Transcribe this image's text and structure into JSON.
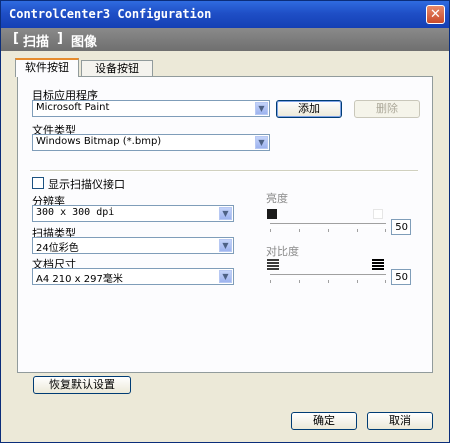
{
  "window": {
    "title": "ControlCenter3 Configuration"
  },
  "header": {
    "tab_scan": "扫描",
    "tab_image": "图像",
    "bracket_left": "[",
    "bracket_right": "]"
  },
  "tabs": [
    {
      "label": "软件按钮"
    },
    {
      "label": "设备按钮"
    }
  ],
  "target_app": {
    "label": "目标应用程序",
    "value": "Microsoft Paint",
    "add_label": "添加",
    "delete_label": "删除"
  },
  "file_type": {
    "label": "文件类型",
    "value": "Windows Bitmap (*.bmp)"
  },
  "show_interface": {
    "label": "显示扫描仪接口",
    "checked": false
  },
  "resolution": {
    "label": "分辨率",
    "value": "300 x 300 dpi"
  },
  "scan_type": {
    "label": "扫描类型",
    "value": "24位彩色"
  },
  "doc_size": {
    "label": "文档尺寸",
    "value": "A4 210 x 297毫米"
  },
  "brightness": {
    "label": "亮度",
    "value": "50"
  },
  "contrast": {
    "label": "对比度",
    "value": "50"
  },
  "restore_label": "恢复默认设置",
  "ok_label": "确定",
  "cancel_label": "取消",
  "icons": {
    "close": "close-icon",
    "dropdown": "chevron-down-icon"
  }
}
